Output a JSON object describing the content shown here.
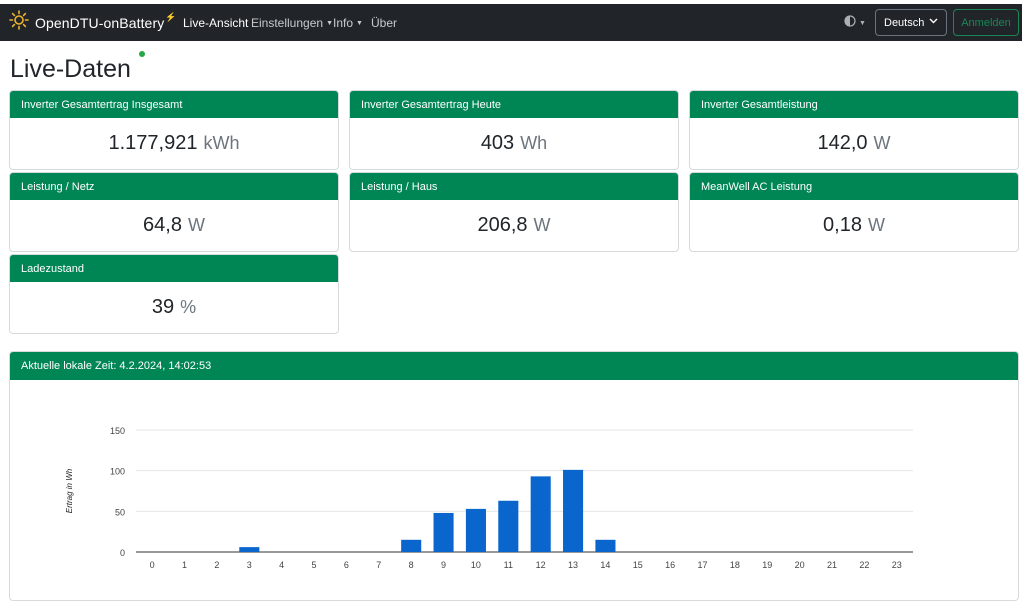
{
  "navbar": {
    "brand": "OpenDTU-onBattery",
    "brand_suffix": "⚡",
    "items": [
      {
        "label": "Live-Ansicht",
        "active": true,
        "dropdown": false
      },
      {
        "label": "Einstellungen",
        "active": false,
        "dropdown": true
      },
      {
        "label": "Info",
        "active": false,
        "dropdown": true
      },
      {
        "label": "Über",
        "active": false,
        "dropdown": false
      }
    ],
    "language": "Deutsch",
    "login_label": "Anmelden",
    "theme_icon": "half-circle-icon"
  },
  "page": {
    "title": "Live-Daten"
  },
  "cards": [
    {
      "title": "Inverter Gesamtertrag Insgesamt",
      "value": "1.177,921",
      "unit": "kWh"
    },
    {
      "title": "Inverter Gesamtertrag Heute",
      "value": "403",
      "unit": "Wh"
    },
    {
      "title": "Inverter Gesamtleistung",
      "value": "142,0",
      "unit": "W"
    },
    {
      "title": "Leistung / Netz",
      "value": "64,8",
      "unit": "W"
    },
    {
      "title": "Leistung / Haus",
      "value": "206,8",
      "unit": "W"
    },
    {
      "title": "MeanWell AC Leistung",
      "value": "0,18",
      "unit": "W"
    },
    {
      "title": "Ladezustand",
      "value": "39",
      "unit": "%"
    }
  ],
  "chart_section": {
    "title": "Aktuelle lokale Zeit: 4.2.2024, 14:02:53"
  },
  "colors": {
    "accent": "#008655",
    "navbar": "#212529",
    "bar": "#0a66cc",
    "login": "#198754"
  },
  "chart_data": {
    "type": "bar",
    "categories": [
      "0",
      "1",
      "2",
      "3",
      "4",
      "5",
      "6",
      "7",
      "8",
      "9",
      "10",
      "11",
      "12",
      "13",
      "14",
      "15",
      "16",
      "17",
      "18",
      "19",
      "20",
      "21",
      "22",
      "23"
    ],
    "values": [
      0,
      0,
      0,
      6,
      0,
      0,
      0,
      0,
      15,
      48,
      53,
      63,
      93,
      101,
      15,
      0,
      0,
      0,
      0,
      0,
      0,
      0,
      0,
      0
    ],
    "ylabel": "Ertrag in Wh",
    "xlabel": "",
    "yticks": [
      0,
      50,
      100,
      150
    ],
    "ylim": [
      0,
      150
    ],
    "grid": true,
    "legend": false
  }
}
